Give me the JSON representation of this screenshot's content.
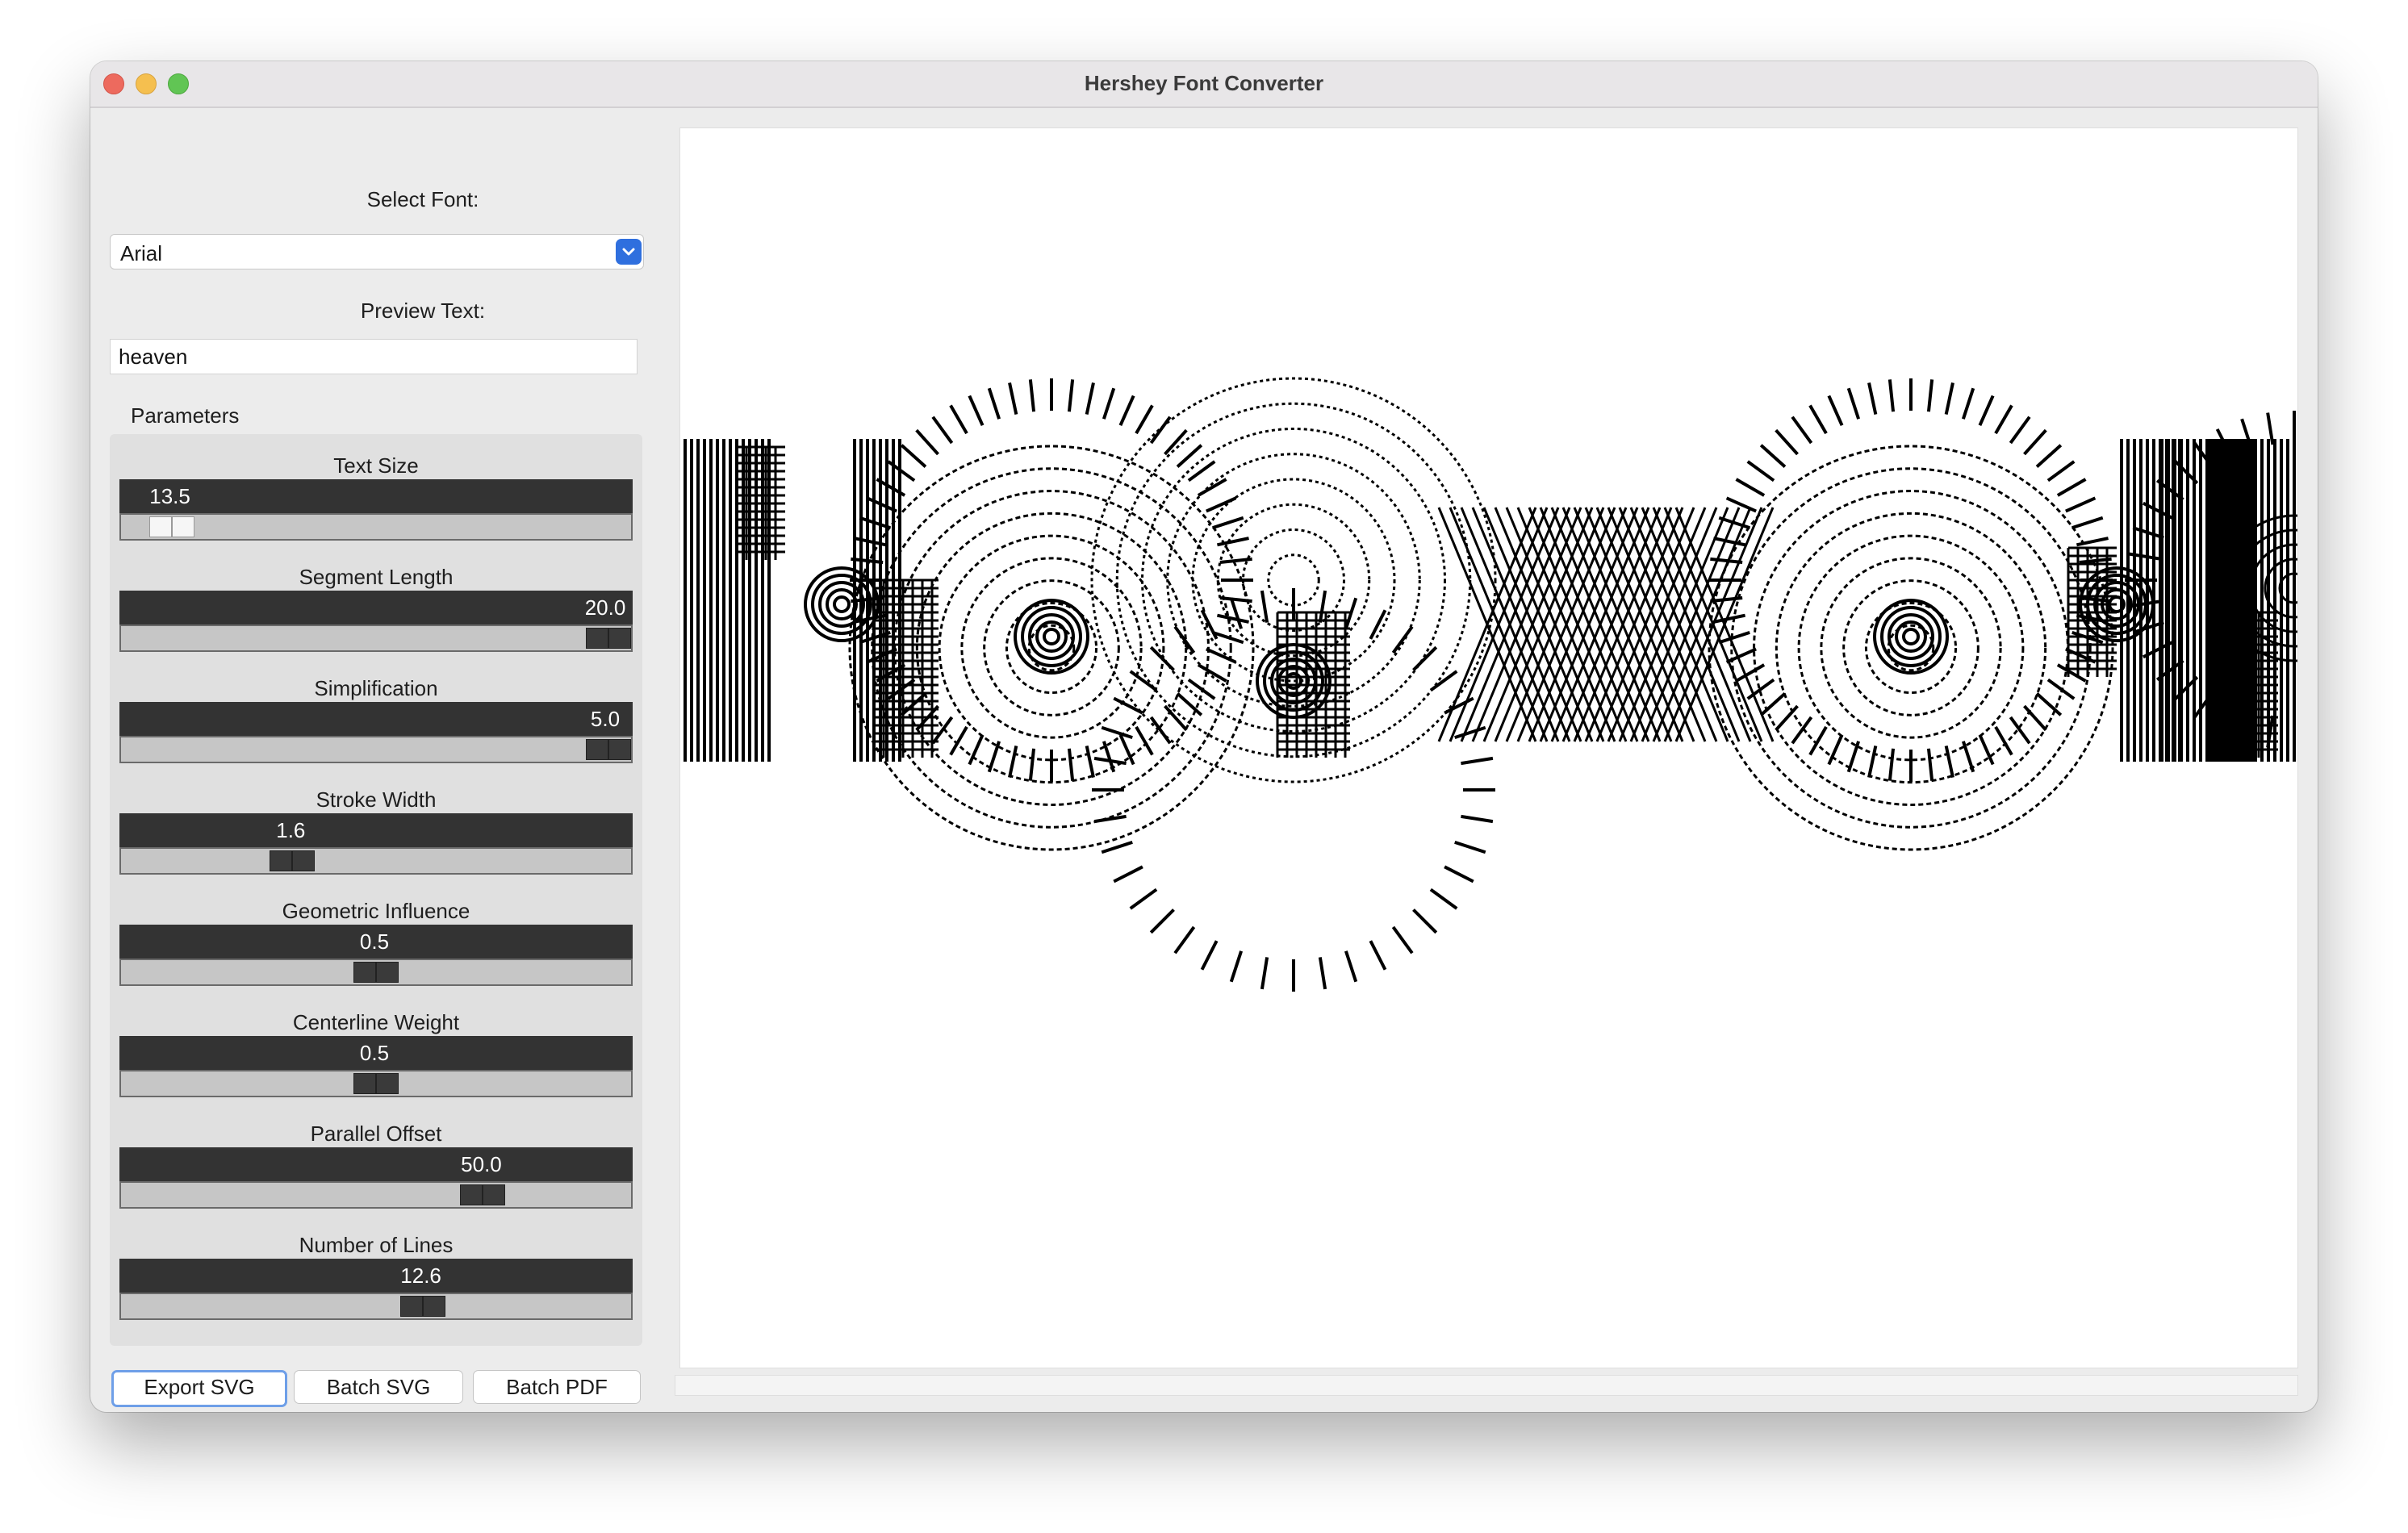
{
  "window": {
    "title": "Hershey Font Converter"
  },
  "sidebar": {
    "font_label": "Select Font:",
    "font_value": "Arial",
    "preview_label": "Preview Text:",
    "preview_value": "heaven",
    "parameters_title": "Parameters",
    "parameters": [
      {
        "label": "Text Size",
        "value": "13.5",
        "fraction": 0.06
      },
      {
        "label": "Segment Length",
        "value": "20.0",
        "fraction": 1.0
      },
      {
        "label": "Simplification",
        "value": "5.0",
        "fraction": 1.0
      },
      {
        "label": "Stroke Width",
        "value": "1.6",
        "fraction": 0.32
      },
      {
        "label": "Geometric Influence",
        "value": "0.5",
        "fraction": 0.5
      },
      {
        "label": "Centerline Weight",
        "value": "0.5",
        "fraction": 0.5
      },
      {
        "label": "Parallel Offset",
        "value": "50.0",
        "fraction": 0.73
      },
      {
        "label": "Number of Lines",
        "value": "12.6",
        "fraction": 0.6
      }
    ]
  },
  "buttons": {
    "export_svg": "Export SVG",
    "batch_svg": "Batch SVG",
    "batch_pdf": "Batch PDF"
  },
  "colors": {
    "accent": "#2f6fde",
    "slider_bar": "#333333",
    "track": "#c6c6c6"
  },
  "icons": {
    "dropdown": "chevron-down-icon"
  }
}
